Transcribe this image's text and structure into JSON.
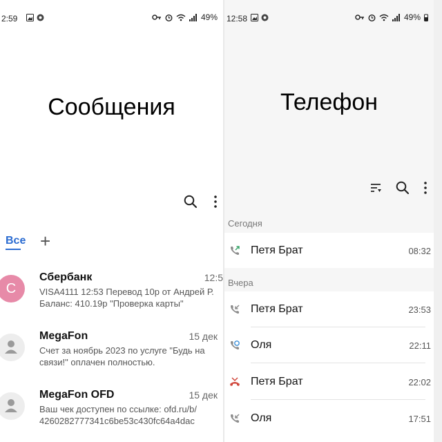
{
  "left": {
    "status": {
      "time": "2:59",
      "battery": "49%"
    },
    "title": "Сообщения",
    "tabs": {
      "all": "Все",
      "add": "+"
    },
    "messages": [
      {
        "avatar_letter": "С",
        "name": "Сбербанк",
        "time": "12:5",
        "body": "VISA4111 12:53 Перевод 10р от Андрей Р. Баланс: 410.19р \"Проверка карты\""
      },
      {
        "avatar_letter": "",
        "name": "MegaFon",
        "time": "15 дек",
        "body": "Счет за ноябрь 2023 по услуге \"Будь на связи!\" оплачен полностью."
      },
      {
        "avatar_letter": "",
        "name": "MegaFon OFD",
        "time": "15 дек",
        "body": "Ваш чек доступен по ссылке: ofd.ru/b/ 4260282777341c6be53c430fc64a4dac"
      }
    ]
  },
  "right": {
    "status": {
      "time": "12:58",
      "battery": "49%"
    },
    "title": "Телефон",
    "sections": [
      {
        "label": "Сегодня",
        "calls": [
          {
            "name": "Петя Брат",
            "time": "08:32",
            "type": "outgoing"
          }
        ]
      },
      {
        "label": "Вчера",
        "calls": [
          {
            "name": "Петя Брат",
            "time": "23:53",
            "type": "incoming"
          },
          {
            "name": "Оля",
            "time": "22:11",
            "type": "voicemail"
          },
          {
            "name": "Петя Брат",
            "time": "22:02",
            "type": "missed"
          },
          {
            "name": "Оля",
            "time": "17:51",
            "type": "incoming"
          }
        ]
      }
    ]
  },
  "colors": {
    "accent": "#2a6bd1",
    "avatar_pink": "#e78aa8",
    "outgoing": "#3aa56b",
    "missed": "#d0463b",
    "voicemail": "#3b8fd8"
  }
}
